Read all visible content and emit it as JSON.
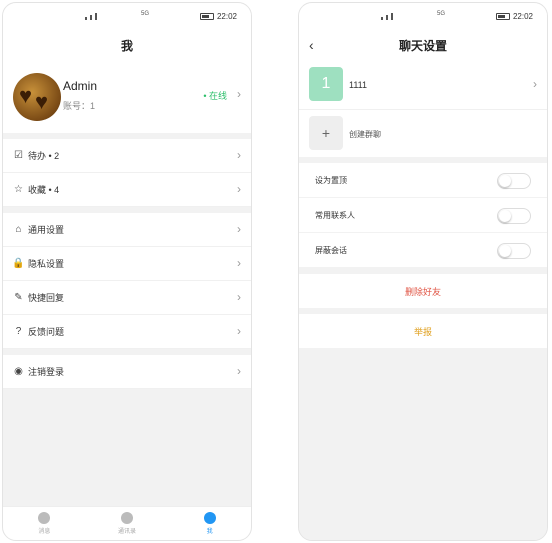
{
  "left": {
    "status_time": "22:02",
    "status_net": "5G",
    "title": "我",
    "profile": {
      "name": "Admin",
      "account": "账号：1",
      "online": "• 在线"
    },
    "group1": [
      {
        "icon": "checkbox-icon",
        "glyph": "☑",
        "label": "待办 • 2"
      },
      {
        "icon": "star-icon",
        "glyph": "☆",
        "label": "收藏 • 4"
      }
    ],
    "group2": [
      {
        "icon": "general-settings-icon",
        "glyph": "⌂",
        "label": "通用设置"
      },
      {
        "icon": "lock-icon",
        "glyph": "🔒",
        "label": "隐私设置"
      },
      {
        "icon": "edit-icon",
        "glyph": "✎",
        "label": "快捷回复"
      },
      {
        "icon": "question-icon",
        "glyph": "?",
        "label": "反馈问题"
      }
    ],
    "group3": [
      {
        "icon": "logout-icon",
        "glyph": "◉",
        "label": "注销登录"
      }
    ],
    "tabs": [
      {
        "label": "消息",
        "icon": "message-icon"
      },
      {
        "label": "通讯录",
        "icon": "contacts-icon"
      },
      {
        "label": "我",
        "icon": "profile-icon"
      }
    ]
  },
  "right": {
    "status_time": "22:02",
    "status_net": "5G",
    "title": "聊天设置",
    "back": "‹",
    "contact": {
      "initial": "1",
      "name": "1111"
    },
    "group": {
      "plus": "+",
      "label": "创建群聊"
    },
    "toggles": [
      {
        "label": "设为置顶",
        "on": false
      },
      {
        "label": "常用联系人",
        "on": false
      },
      {
        "label": "屏蔽会话",
        "on": false
      }
    ],
    "delete_label": "删除好友",
    "report_label": "举报"
  },
  "colors": {
    "online": "#2bbf6a",
    "active_tab": "#2196f3",
    "danger": "#e05545",
    "warn": "#e0a020",
    "avatar_badge": "#9ee0c0"
  }
}
